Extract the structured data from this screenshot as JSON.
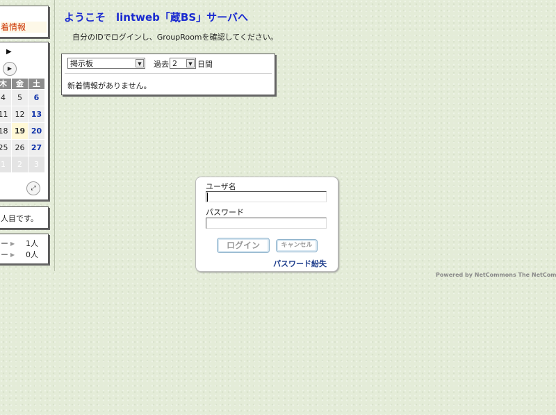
{
  "left": {
    "new_info_label": "着情報",
    "calendar": {
      "weekday_headers": [
        "木",
        "金",
        "土"
      ],
      "rows": [
        [
          "4",
          "5",
          "6"
        ],
        [
          "11",
          "12",
          "13"
        ],
        [
          "18",
          "19",
          "20"
        ],
        [
          "25",
          "26",
          "27"
        ],
        [
          "1",
          "2",
          "3"
        ]
      ],
      "today": "19"
    },
    "visitor_text": "人目です。",
    "online": [
      {
        "name": "ー",
        "count": "1人"
      },
      {
        "name": "ー",
        "count": "0人"
      }
    ]
  },
  "main": {
    "title": "ようこそ　lintweb「蔵BS」サーバへ",
    "message": "自分のIDでログインし、GroupRoomを確認してください。",
    "board": {
      "select_value": "掲示板",
      "past_label": "過去",
      "days_value": "2",
      "days_unit": "日間",
      "empty_message": "新着情報がありません。"
    }
  },
  "login": {
    "username_label": "ユーザ名",
    "password_label": "パスワード",
    "login_button": "ログイン",
    "cancel_button": "キャンセル",
    "forgot_password": "パスワード紛失"
  },
  "footer": {
    "powered": "Powered by NetCommons  The NetComm"
  }
}
